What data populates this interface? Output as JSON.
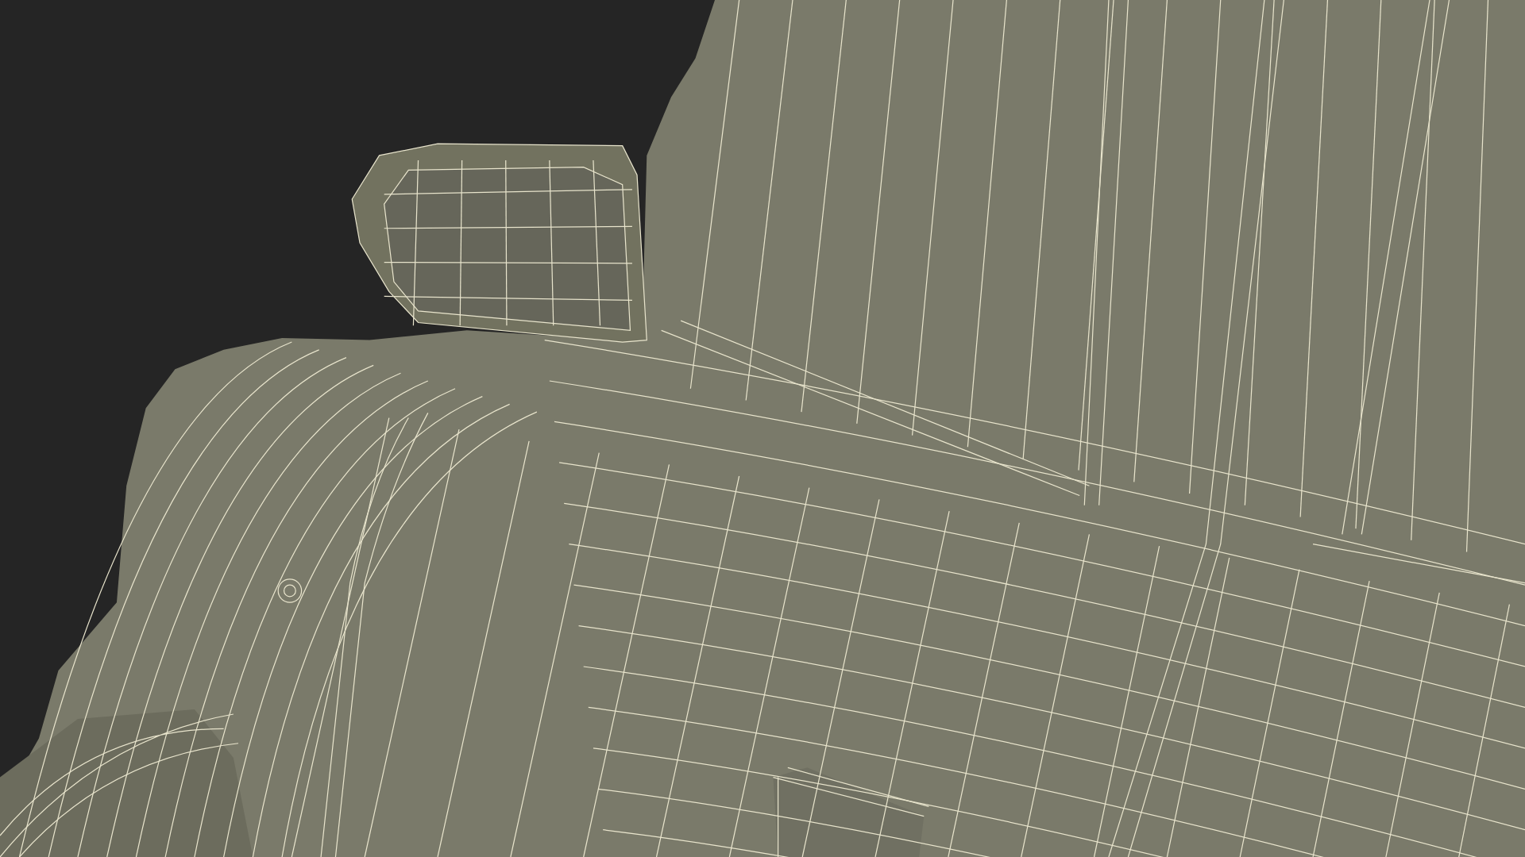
{
  "viewport": {
    "kind": "wireframe"
  }
}
